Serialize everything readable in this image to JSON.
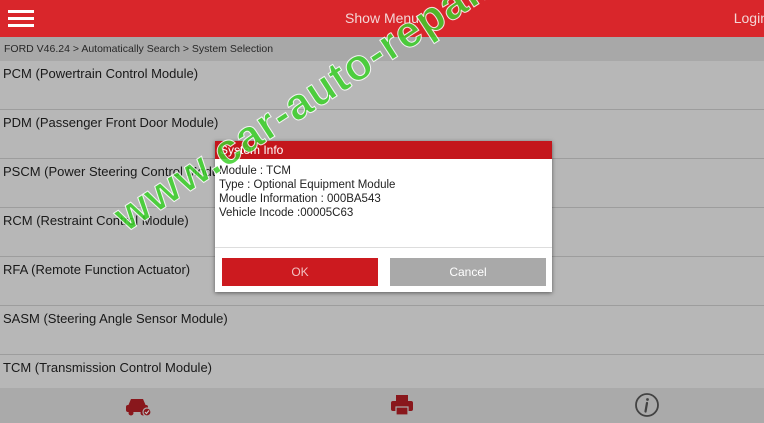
{
  "header": {
    "title": "Show Menu",
    "login_label": "Login"
  },
  "breadcrumb": "FORD V46.24 > Automatically Search > System Selection",
  "systems": [
    "PCM (Powertrain Control Module)",
    "PDM (Passenger Front Door Module)",
    "PSCM (Power Steering Control Module)",
    "RCM (Restraint Control Module)",
    "RFA (Remote Function Actuator)",
    "SASM (Steering Angle Sensor Module)",
    "TCM (Transmission Control Module)"
  ],
  "dialog": {
    "title": "System Info",
    "lines": [
      "Module : TCM",
      "Type : Optional Equipment Module",
      "Moudle Information : 000BA543",
      "Vehicle Incode :00005C63"
    ],
    "ok_label": "OK",
    "cancel_label": "Cancel"
  },
  "bottom_icons": [
    "car-diagnose-icon",
    "printer-icon",
    "info-icon"
  ],
  "watermark": "www.car-auto-repair.com",
  "colors": {
    "header": "#d9262b",
    "ok": "#cc1a1f",
    "cancel": "#a9a9a9",
    "watermark": "#3bd12a"
  }
}
